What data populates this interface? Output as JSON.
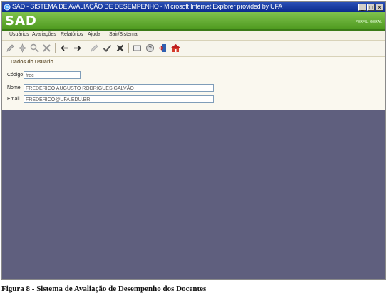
{
  "window": {
    "title": "SAD - SISTEMA DE AVALIAÇÃO DE DESEMPENHO - Microsoft Internet Explorer provided by UFA",
    "icon": "ie-icon",
    "buttons": {
      "minimize": "_",
      "maximize": "□",
      "close": "×"
    }
  },
  "header": {
    "logo": "SAD",
    "right_text": "PERFIL: GERAL"
  },
  "menu": {
    "items": [
      "Usuários",
      "Avaliações",
      "Relatórios",
      "Ajuda",
      "Sair/Sistema"
    ]
  },
  "toolbar": {
    "icons": [
      "edit-icon",
      "new-icon",
      "search-icon",
      "delete-icon",
      "back-icon",
      "forward-icon",
      "edit-disabled-icon",
      "confirm-icon",
      "cancel-icon",
      "print-icon",
      "help-icon",
      "logout-icon",
      "home-icon"
    ]
  },
  "form": {
    "legend": "Dados do Usuário",
    "fields": {
      "codigo": {
        "label": "Código",
        "value": "frec"
      },
      "nome": {
        "label": "Nome",
        "value": "FREDERICO AUGUSTO RODRIGUES GALVÃO"
      },
      "email": {
        "label": "Email",
        "value": "FREDERICO@UFA.EDU.BR"
      }
    }
  },
  "caption": "Figura 8 - Sistema de Avaliação de Desempenho dos Docentes",
  "colors": {
    "title_bar": "#0a2a8c",
    "header_green": "#5fa82c",
    "workspace": "#5f5f7e"
  }
}
